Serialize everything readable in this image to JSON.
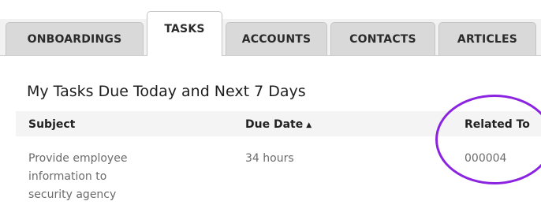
{
  "tabs": [
    {
      "label": "ONBOARDINGS",
      "active": false
    },
    {
      "label": "TASKS",
      "active": true
    },
    {
      "label": "ACCOUNTS",
      "active": false
    },
    {
      "label": "CONTACTS",
      "active": false
    },
    {
      "label": "ARTICLES",
      "active": false
    }
  ],
  "section": {
    "title": "My Tasks Due Today and Next 7 Days"
  },
  "table": {
    "columns": [
      {
        "label": "Subject"
      },
      {
        "label": "Due Date",
        "sort": "ascending"
      },
      {
        "label": "Related To"
      }
    ],
    "rows": [
      {
        "subject": "Provide employee\ninformation to\nsecurity agency",
        "due_date": "34 hours",
        "related_to": "000004"
      }
    ]
  },
  "icons": {
    "sort_arrow": "sort-ascending-icon"
  },
  "colors": {
    "annotation_circle": "#8b24e0",
    "active_tab": "#ffffff",
    "inactive_tab": "#d9d9d9",
    "cell_text": "#6b6b6b"
  }
}
